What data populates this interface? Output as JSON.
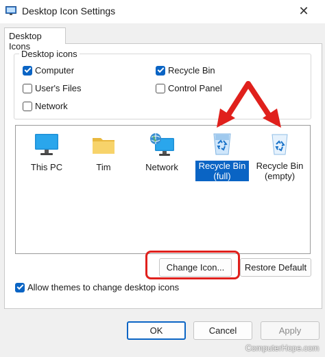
{
  "window": {
    "title": "Desktop Icon Settings",
    "close_symbol": "✕",
    "app_icon": "desktop-settings-icon"
  },
  "tabs": [
    {
      "label": "Desktop Icons"
    }
  ],
  "desktop_icons_group": {
    "legend": "Desktop icons",
    "checkboxes": [
      {
        "label": "Computer",
        "checked": true
      },
      {
        "label": "Recycle Bin",
        "checked": true
      },
      {
        "label": "User's Files",
        "checked": false
      },
      {
        "label": "Control Panel",
        "checked": false
      },
      {
        "label": "Network",
        "checked": false
      }
    ]
  },
  "icon_list": [
    {
      "label": "This PC",
      "icon": "monitor-icon",
      "selected": false
    },
    {
      "label": "Tim",
      "icon": "folder-icon",
      "selected": false
    },
    {
      "label": "Network",
      "icon": "network-icon",
      "selected": false
    },
    {
      "label_line1": "Recycle Bin",
      "label_line2": "(full)",
      "icon": "recycle-bin-full-icon",
      "selected": true
    },
    {
      "label_line1": "Recycle Bin",
      "label_line2": "(empty)",
      "icon": "recycle-bin-empty-icon",
      "selected": false
    }
  ],
  "buttons": {
    "change_icon": "Change Icon...",
    "restore_default": "Restore Default",
    "ok": "OK",
    "cancel": "Cancel",
    "apply": "Apply"
  },
  "allow_themes": {
    "label": "Allow themes to change desktop icons",
    "checked": true
  },
  "annotation_color": "#e0201c",
  "accent_color": "#0a64c4",
  "watermark": "ComputerHope.com"
}
